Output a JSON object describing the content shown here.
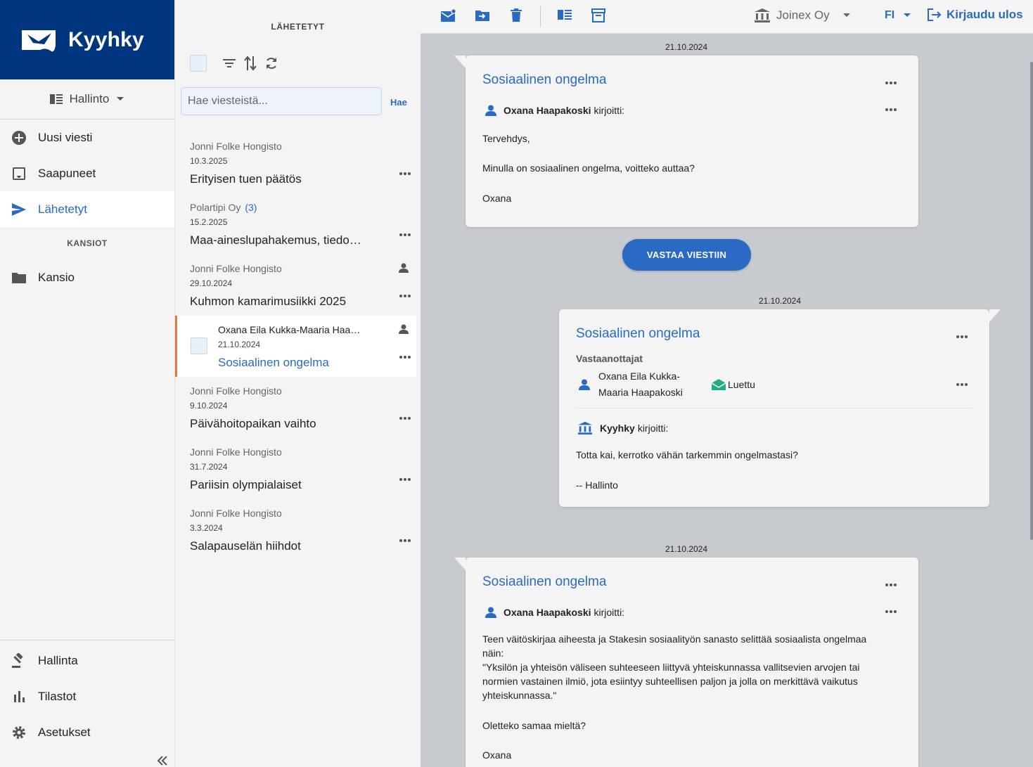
{
  "app": {
    "brand": "Kyyhky"
  },
  "nav": {
    "org_selector": "Hallinto",
    "items": [
      {
        "label": "Uusi viesti"
      },
      {
        "label": "Saapuneet"
      },
      {
        "label": "Lähetetyt"
      }
    ],
    "folders_heading": "KANSIOT",
    "folders": [
      {
        "label": "Kansio"
      }
    ],
    "bottom": [
      {
        "label": "Hallinta"
      },
      {
        "label": "Tilastot"
      },
      {
        "label": "Asetukset"
      }
    ]
  },
  "list": {
    "title": "LÄHETETYT",
    "search_placeholder": "Hae viesteistä...",
    "search_button": "Hae",
    "messages": [
      {
        "from": "Jonni Folke Hongisto",
        "count": "",
        "date": "10.3.2025",
        "subject": "Erityisen tuen päätös"
      },
      {
        "from": "Polartipi Oy",
        "count": "(3)",
        "date": "15.2.2025",
        "subject": "Maa-aineslupahakemus, tiedoksianto"
      },
      {
        "from": "Jonni Folke Hongisto",
        "count": "",
        "date": "29.10.2024",
        "subject": "Kuhmon kamarimusiikki 2025"
      },
      {
        "from": "Oxana Eila Kukka-Maaria Haapakoski",
        "count": "",
        "date": "21.10.2024",
        "subject": "Sosiaalinen ongelma"
      },
      {
        "from": "Jonni Folke Hongisto",
        "count": "",
        "date": "9.10.2024",
        "subject": "Päivähoitopaikan vaihto"
      },
      {
        "from": "Jonni Folke Hongisto",
        "count": "",
        "date": "31.7.2024",
        "subject": "Pariisin olympialaiset"
      },
      {
        "from": "Jonni Folke Hongisto",
        "count": "",
        "date": "3.3.2024",
        "subject": "Salapauselän hiihdot"
      }
    ]
  },
  "topbar": {
    "company": "Joinex Oy",
    "language": "FI",
    "logout": "Kirjaudu ulos"
  },
  "thread": {
    "reply_button": "VASTAA VIESTIIN",
    "messages": [
      {
        "date": "21.10.2024",
        "title": "Sosiaalinen ongelma",
        "author": "Oxana Haapakoski",
        "wrote": "kirjoitti:",
        "paragraphs": [
          "Tervehdys,",
          "Minulla on sosiaalinen ongelma, voitteko auttaa?",
          "Oxana"
        ]
      },
      {
        "date": "21.10.2024",
        "title": "Sosiaalinen ongelma",
        "recipients_heading": "Vastaanottajat",
        "recipient": "Oxana Eila Kukka-Maaria Haapakoski",
        "read_status": "Luettu",
        "author": "Kyyhky",
        "wrote": "kirjoitti:",
        "paragraphs": [
          "Totta kai, kerrotko vähän tarkemmin ongelmastasi?",
          "-- Hallinto"
        ]
      },
      {
        "date": "21.10.2024",
        "title": "Sosiaalinen ongelma",
        "author": "Oxana Haapakoski",
        "wrote": "kirjoitti:",
        "paragraphs": [
          "Teen väitöskirjaa aiheesta ja Stakesin sosiaalityön sanasto selittää sosiaalista ongelmaa näin:",
          "\"Yksilön ja yhteisön väliseen suhteeseen liittyvä yhteiskunnassa vallitsevien arvojen tai normien vastainen ilmiö, jota esiintyy suhteellisen paljon ja jolla on merkittävä vaikutus yhteiskunnassa.\"",
          "Oletteko samaa mieltä?",
          "Oxana"
        ]
      }
    ]
  },
  "colors": {
    "brand": "#003580",
    "accent": "#2a6ac4",
    "selected_marker": "#e07b39",
    "read_icon": "#1fae8c"
  }
}
